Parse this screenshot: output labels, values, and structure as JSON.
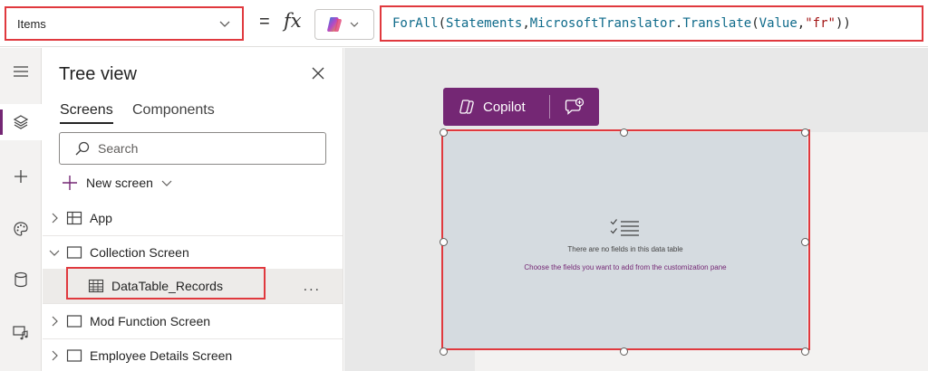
{
  "formula_bar": {
    "property": "Items",
    "equals": "=",
    "fx": "fx",
    "formula_tokens": [
      {
        "t": "ForAll",
        "k": "fn"
      },
      {
        "t": "(",
        "k": "punc"
      },
      {
        "t": "Statements",
        "k": "id"
      },
      {
        "t": ",",
        "k": "punc"
      },
      {
        "t": "MicrosoftTranslator",
        "k": "id"
      },
      {
        "t": ".",
        "k": "punc"
      },
      {
        "t": "Translate",
        "k": "fn"
      },
      {
        "t": "(",
        "k": "punc"
      },
      {
        "t": "Value",
        "k": "id"
      },
      {
        "t": ",",
        "k": "punc"
      },
      {
        "t": "\"fr\"",
        "k": "str"
      },
      {
        "t": "))",
        "k": "punc"
      }
    ]
  },
  "rail": {
    "items": [
      {
        "name": "menu-icon"
      },
      {
        "name": "layers-icon",
        "active": true
      },
      {
        "name": "plus-icon"
      },
      {
        "name": "palette-icon"
      },
      {
        "name": "database-icon"
      },
      {
        "name": "media-icon"
      }
    ]
  },
  "tree_view": {
    "title": "Tree view",
    "tabs": {
      "screens": "Screens",
      "components": "Components"
    },
    "search_placeholder": "Search",
    "new_screen_label": "New screen",
    "items": {
      "app": "App",
      "collection_screen": "Collection Screen",
      "datatable_records": "DataTable_Records",
      "mod_function_screen": "Mod Function Screen",
      "employee_details_screen": "Employee Details Screen"
    },
    "more": "..."
  },
  "canvas": {
    "copilot_label": "Copilot",
    "datatable": {
      "empty_text": "There are no fields in this data table",
      "hint_text": "Choose the fields you want to add from the customization pane"
    }
  },
  "colors": {
    "accent": "#742774",
    "highlight": "#e0393e",
    "table_bg": "#d5dbe0"
  }
}
